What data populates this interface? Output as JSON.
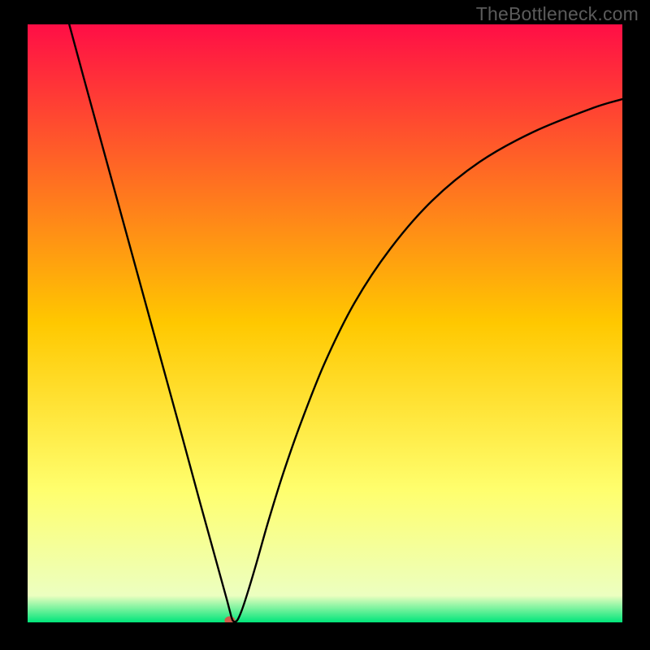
{
  "watermark": "TheBottleneck.com",
  "chart_data": {
    "type": "line",
    "title": "",
    "xlabel": "",
    "ylabel": "",
    "xlim": [
      0,
      100
    ],
    "ylim": [
      0,
      100
    ],
    "background_gradient": [
      {
        "pos": 0.0,
        "color": "#ff0e46"
      },
      {
        "pos": 0.5,
        "color": "#ffc800"
      },
      {
        "pos": 0.78,
        "color": "#ffff6e"
      },
      {
        "pos": 0.955,
        "color": "#ecffc0"
      },
      {
        "pos": 1.0,
        "color": "#00e57a"
      }
    ],
    "series": [
      {
        "name": "curve",
        "color": "#000000",
        "x": [
          7,
          10,
          14,
          18,
          22,
          26,
          29,
          31,
          32.5,
          33.5,
          34.0,
          34.5,
          35.2,
          36.0,
          37.0,
          38.5,
          40.5,
          43.0,
          46.0,
          50.0,
          55.0,
          61.0,
          68.0,
          76.0,
          85.0,
          95.0,
          100.0
        ],
        "y": [
          100,
          89,
          74.5,
          60,
          45.5,
          31,
          20,
          12.8,
          7.4,
          3.8,
          1.9,
          0.3,
          0.3,
          2.0,
          5.0,
          10.0,
          17.0,
          25.0,
          33.5,
          43.5,
          53.5,
          62.5,
          70.5,
          77.0,
          82.0,
          86.0,
          87.5
        ]
      }
    ],
    "marker": {
      "x": 34.0,
      "y": 0.3,
      "color": "#d05a4a",
      "radius": 6.5
    }
  }
}
